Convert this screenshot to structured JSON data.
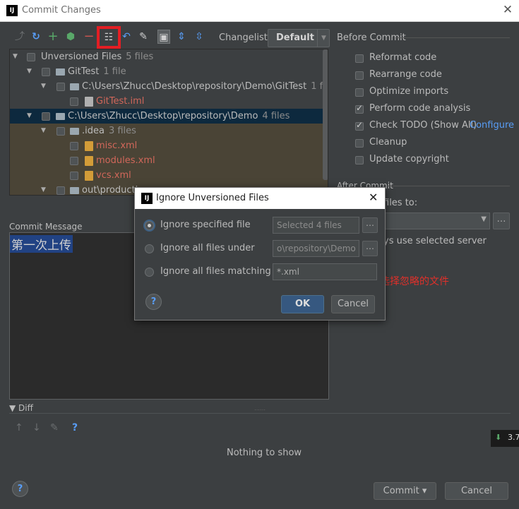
{
  "window": {
    "title": "Commit Changes",
    "app_icon": "IJ"
  },
  "toolbar": {
    "changelist_label": "Changelist:",
    "changelist_value": "Default"
  },
  "tree": {
    "rows": [
      {
        "label": "Unversioned Files",
        "meta": "5 files"
      },
      {
        "label": "GitTest",
        "meta": "1 file"
      },
      {
        "label": "C:\\Users\\Zhucc\\Desktop\\repository\\Demo\\GitTest",
        "meta": "1 file"
      },
      {
        "label": "GitTest.iml",
        "meta": ""
      },
      {
        "label": "C:\\Users\\Zhucc\\Desktop\\repository\\Demo",
        "meta": "4 files"
      },
      {
        "label": ".idea",
        "meta": "3 files"
      },
      {
        "label": "misc.xml",
        "meta": ""
      },
      {
        "label": "modules.xml",
        "meta": ""
      },
      {
        "label": "vcs.xml",
        "meta": ""
      },
      {
        "label": "out\\productio",
        "meta": ""
      }
    ]
  },
  "commit_message": {
    "label": "Commit Message",
    "text": "第一次上传"
  },
  "before_commit": {
    "title": "Before Commit",
    "options": [
      {
        "label": "Reformat code",
        "checked": false
      },
      {
        "label": "Rearrange code",
        "checked": false
      },
      {
        "label": "Optimize imports",
        "checked": false
      },
      {
        "label": "Perform code analysis",
        "checked": true
      },
      {
        "label": "Check TODO (Show All)",
        "checked": true,
        "link": "Configure"
      },
      {
        "label": "Cleanup",
        "checked": false
      },
      {
        "label": "Update copyright",
        "checked": false
      }
    ]
  },
  "after_commit": {
    "title": "After Commit",
    "upload_label": "files to:",
    "always_label": "ys use selected server"
  },
  "annotation": "选择忽略的文件",
  "diff": {
    "title": "Diff",
    "empty_text": "Nothing to show",
    "status_value": "3.7"
  },
  "footer": {
    "commit_label": "Commit ▾",
    "cancel_label": "Cancel"
  },
  "dialog": {
    "title": "Ignore Unversioned Files",
    "option1": "Ignore specified file",
    "option1_value": "Selected 4 files",
    "option2": "Ignore all files under",
    "option2_value": "o\\repository\\Demo",
    "option3": "Ignore all files matching",
    "option3_value": "*.xml",
    "ok_label": "OK",
    "cancel_label": "Cancel"
  },
  "icons": {
    "diff": "arrow-icon",
    "refresh": "refresh-icon",
    "add": "plus-icon",
    "move": "move-icon",
    "remove": "minus-icon",
    "ignore": "ignore-icon",
    "undo": "undo-icon",
    "edit": "edit-icon",
    "group": "group-icon",
    "expand": "expand-icon",
    "collapse": "collapse-icon"
  },
  "colors": {
    "accent": "#589df6",
    "highlight": "#e31e24",
    "annotation": "#e0302a"
  }
}
